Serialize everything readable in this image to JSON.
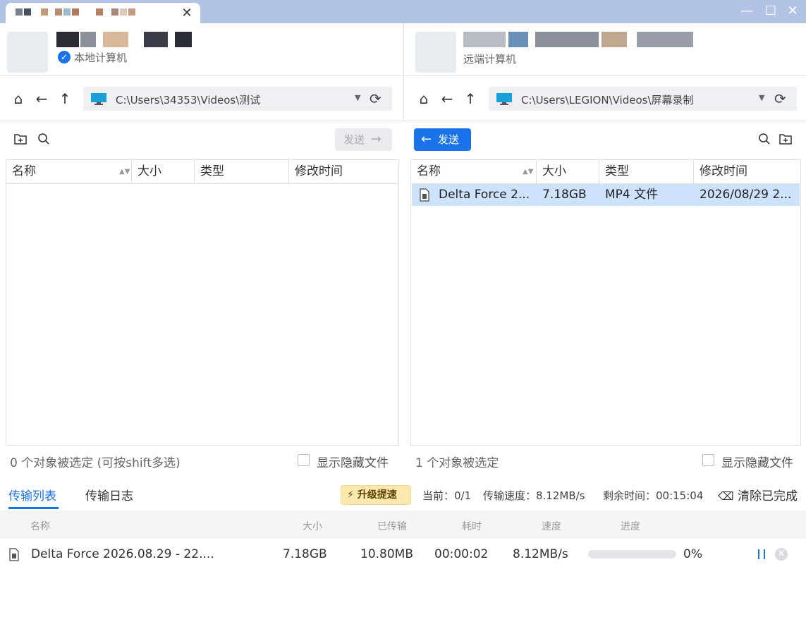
{
  "window": {
    "tab_close": "✕",
    "minimize": "—",
    "maximize": "☐",
    "close": "✕"
  },
  "local": {
    "label": "本地计算机",
    "path": "C:\\Users\\34353\\Videos\\测试",
    "send_label": "发送",
    "columns": [
      "名称",
      "大小",
      "类型",
      "修改时间"
    ],
    "files": [],
    "status": "0 个对象被选定 (可按shift多选)",
    "show_hidden": "显示隐藏文件"
  },
  "remote": {
    "label": "远端计算机",
    "path": "C:\\Users\\LEGION\\Videos\\屏幕录制",
    "send_label": "发送",
    "columns": [
      "名称",
      "大小",
      "类型",
      "修改时间"
    ],
    "files": [
      {
        "name": "Delta Force 2...",
        "size": "7.18GB",
        "type": "MP4 文件",
        "modified": "2026/08/29 2..."
      }
    ],
    "status": "1 个对象被选定",
    "show_hidden": "显示隐藏文件"
  },
  "transfer": {
    "tabs": [
      "传输列表",
      "传输日志"
    ],
    "upgrade": "升级提速",
    "current": "当前：0/1",
    "speed": "传输速度：8.12MB/s",
    "remaining": "剩余时间：00:15:04",
    "clear": "清除已完成",
    "columns": [
      "名称",
      "大小",
      "已传输",
      "耗时",
      "速度",
      "进度"
    ],
    "items": [
      {
        "name": "Delta Force 2026.08.29 - 22....",
        "size": "7.18GB",
        "transferred": "10.80MB",
        "elapsed": "00:00:02",
        "speed": "8.12MB/s",
        "progress_text": "0%",
        "progress": 0
      }
    ]
  },
  "colors": {
    "accent": "#1a73e8",
    "titlebar": "#b3c3e6",
    "selected_row": "#cfe2fc"
  }
}
